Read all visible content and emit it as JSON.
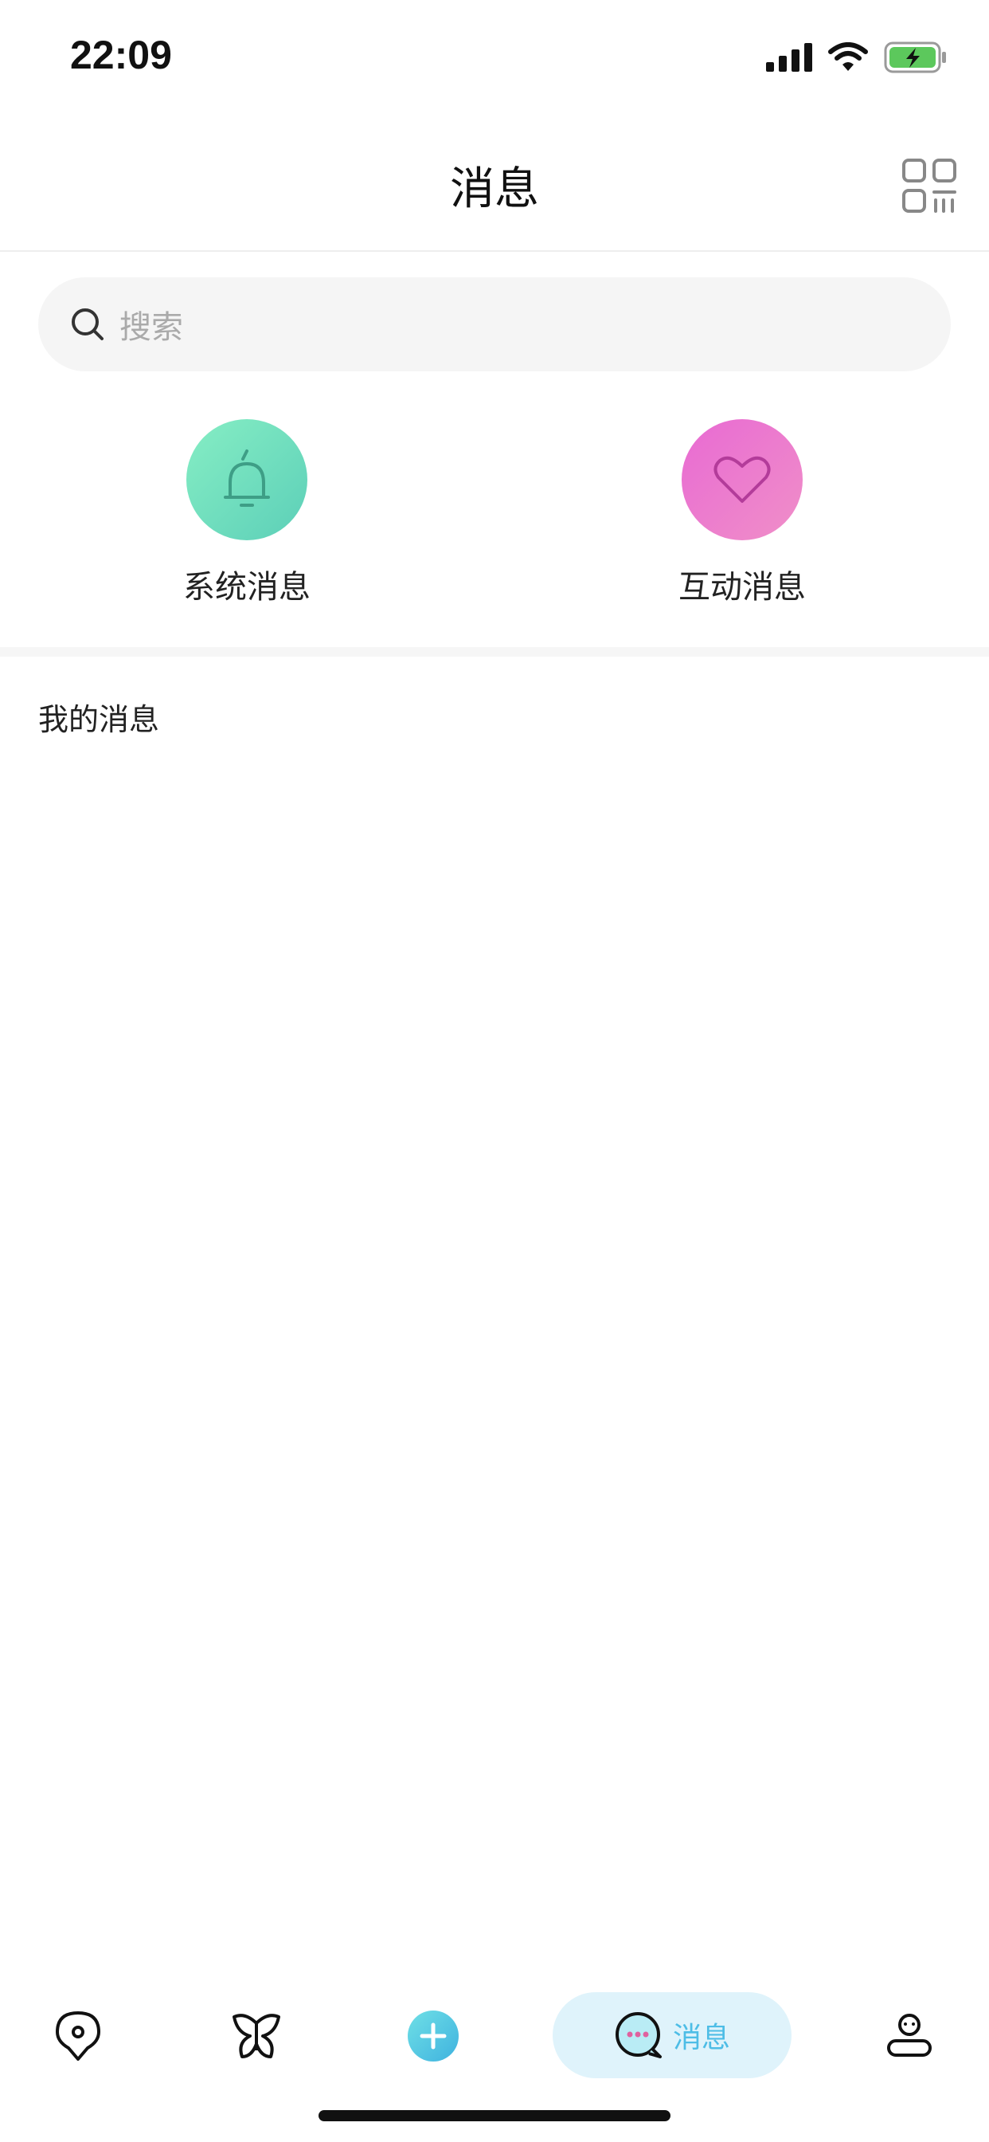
{
  "status_bar": {
    "time": "22:09",
    "icons": [
      "signal-icon",
      "wifi-icon",
      "battery-charging-icon"
    ],
    "battery_color": "#5cc85c"
  },
  "nav": {
    "title": "消息",
    "right_icon": "qr-code-icon"
  },
  "search": {
    "placeholder": "搜索",
    "icon": "search-icon"
  },
  "shortcuts": [
    {
      "label": "系统消息",
      "icon": "bell-icon",
      "color": "#6fdfc0"
    },
    {
      "label": "互动消息",
      "icon": "heart-icon",
      "color": "#ea78cf"
    }
  ],
  "section": {
    "title": "我的消息"
  },
  "tab_bar": {
    "tabs": [
      {
        "icon": "location-pin-icon"
      },
      {
        "icon": "butterfly-icon"
      },
      {
        "icon": "add-icon"
      },
      {
        "icon": "chat-bubble-icon",
        "label": "消息",
        "active": true
      },
      {
        "icon": "profile-icon"
      }
    ],
    "accent": "#4dbde6"
  }
}
